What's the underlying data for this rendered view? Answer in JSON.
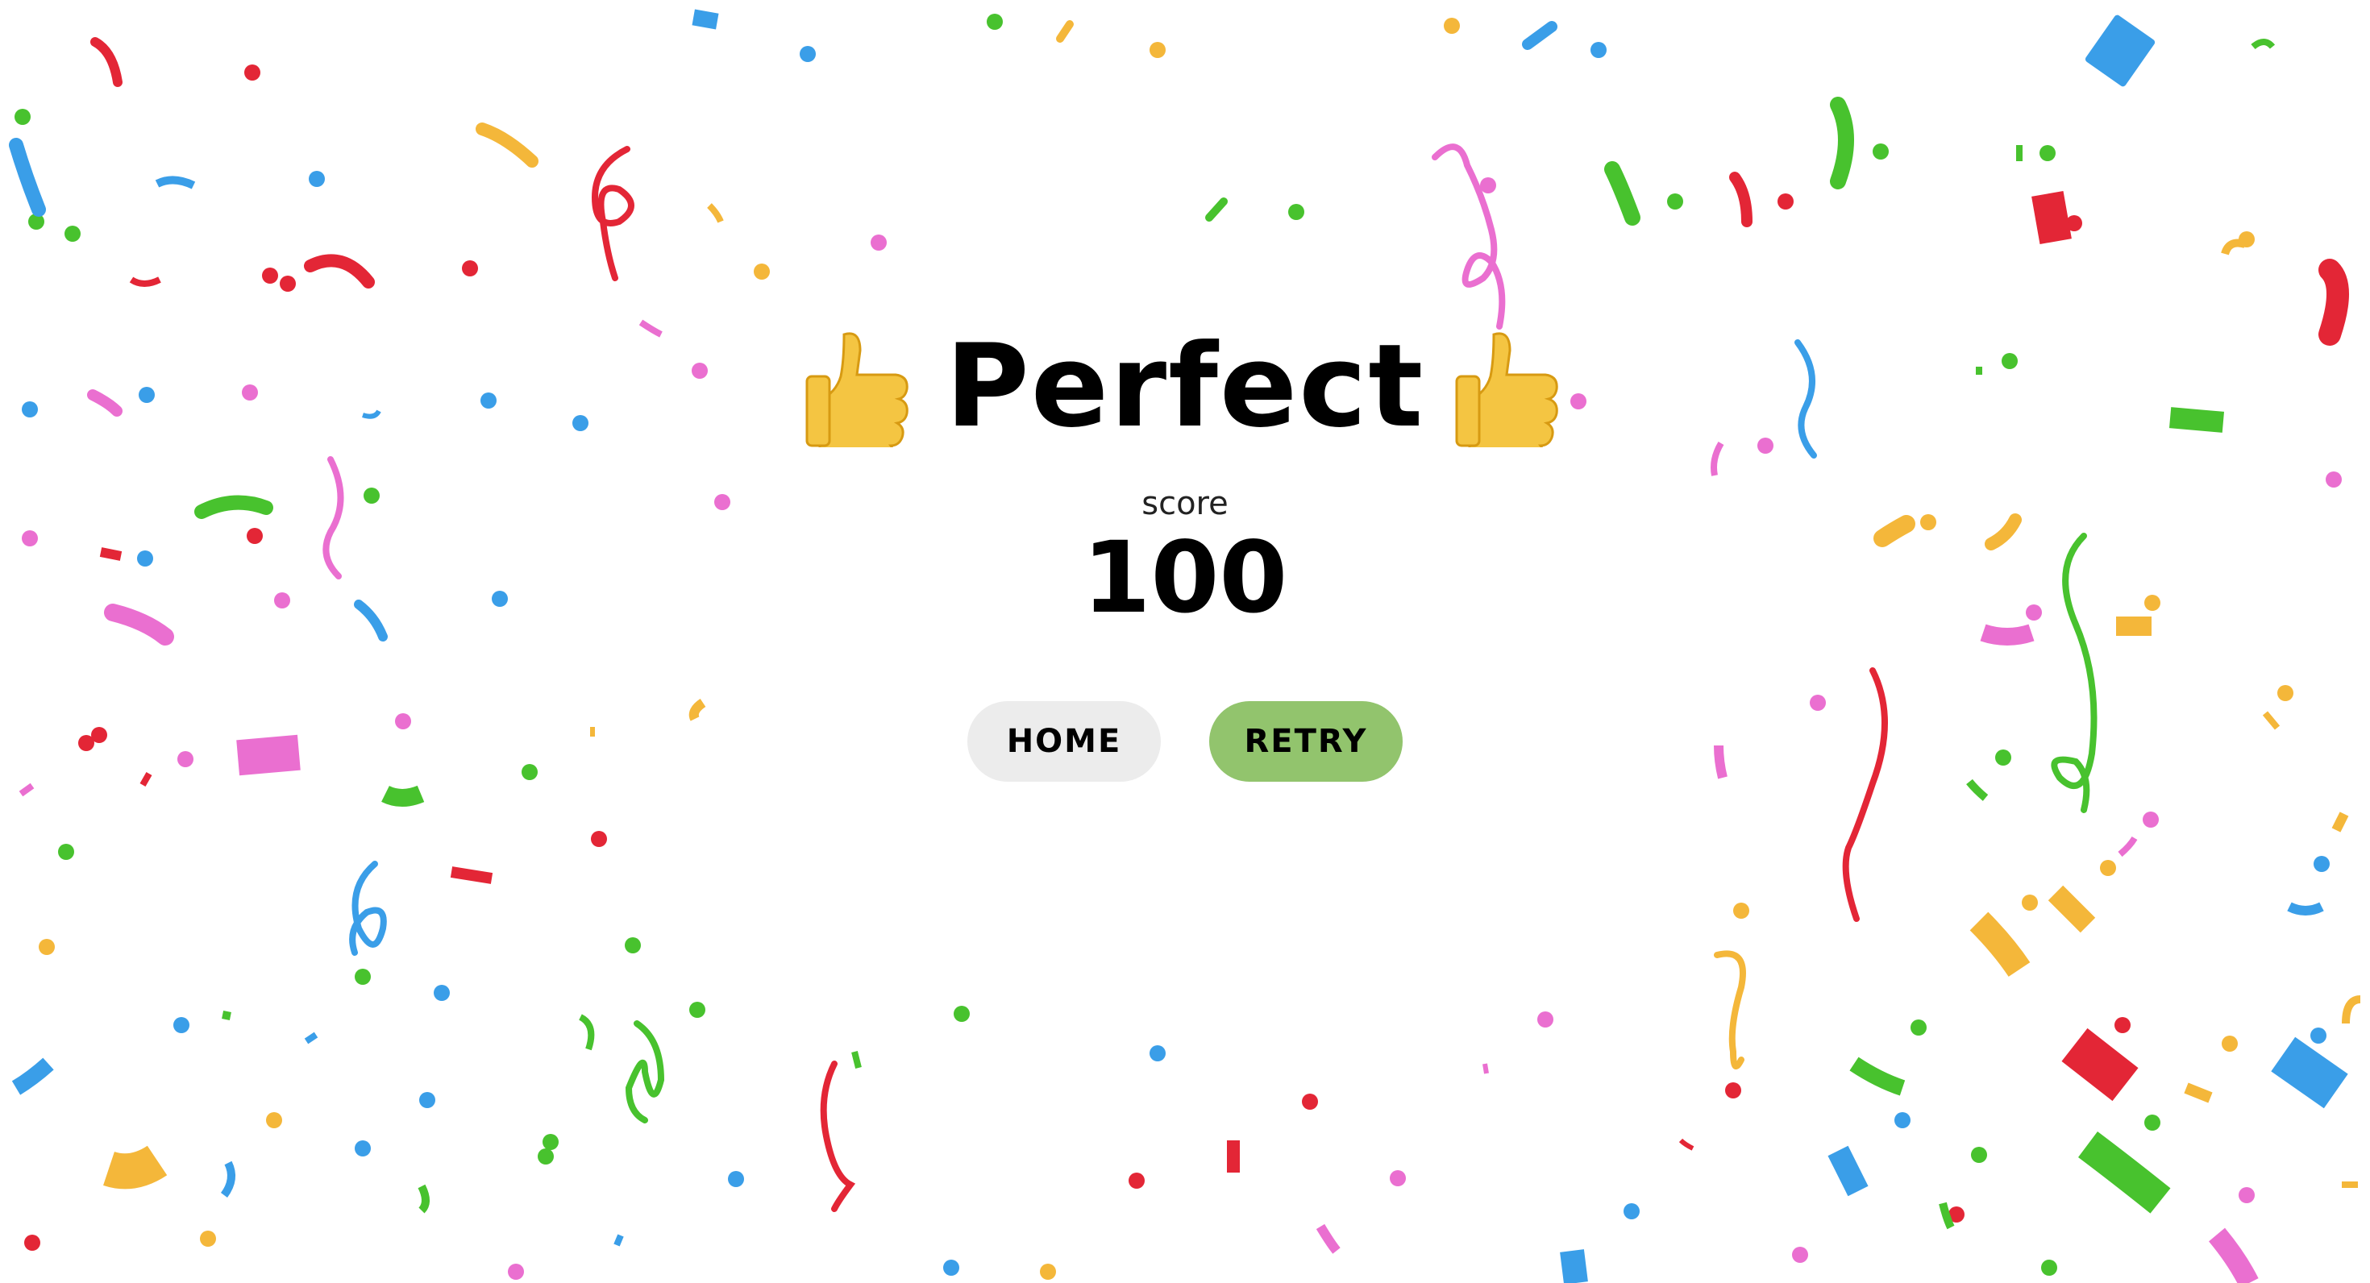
{
  "result": {
    "title": "Perfect",
    "left_emoji_icon": "thumbs-up-icon",
    "right_emoji_icon": "thumbs-up-icon",
    "score_label": "score",
    "score_value": "100"
  },
  "buttons": {
    "home_label": "HOME",
    "retry_label": "RETRY"
  },
  "colors": {
    "background": "#ffffff",
    "home_button": "#ececec",
    "retry_button": "#92c46d",
    "confetti": [
      "#e32636",
      "#3a9ee8",
      "#f4b73a",
      "#48c22e",
      "#ea6fd0"
    ]
  }
}
